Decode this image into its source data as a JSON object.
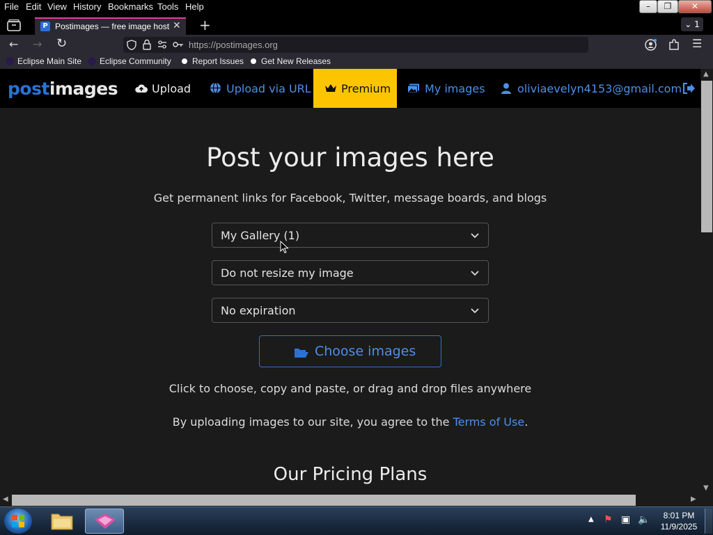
{
  "menubar": {
    "items": [
      "File",
      "Edit",
      "View",
      "History",
      "Bookmarks",
      "Tools",
      "Help"
    ]
  },
  "tabs": {
    "active_title": "Postimages — free image hosting",
    "tab_count": "1",
    "favicon_letter": "P"
  },
  "navbar": {
    "url": "https://postimages.org"
  },
  "bookmarks": {
    "items": [
      "Eclipse Main Site",
      "Eclipse Community",
      "Report Issues",
      "Get New Releases"
    ]
  },
  "site_header": {
    "logo_part1": "post",
    "logo_part2": "images",
    "upload": "Upload",
    "upload_url": "Upload via URL",
    "premium": "Premium",
    "my_images": "My images",
    "email": "oliviaevelyn4153@gmail.com"
  },
  "main": {
    "heading": "Post your images here",
    "subheading": "Get permanent links for Facebook, Twitter, message boards, and blogs",
    "gallery_select": "My Gallery (1)",
    "resize_select": "Do not resize my image",
    "expiration_select": "No expiration",
    "choose_button": "Choose images",
    "choose_hint": "Click to choose, copy and paste, or drag and drop files anywhere",
    "terms_prefix": "By uploading images to our site, you agree to the ",
    "terms_link": "Terms of Use",
    "terms_suffix": ".",
    "pricing_heading": "Our Pricing Plans"
  },
  "taskbar": {
    "time": "8:01 PM",
    "date": "11/9/2025"
  },
  "colors": {
    "accent_blue": "#2a72d6",
    "link_blue": "#4e8fe6",
    "premium_yellow": "#fcc500",
    "tab_indicator": "#e040a0"
  }
}
